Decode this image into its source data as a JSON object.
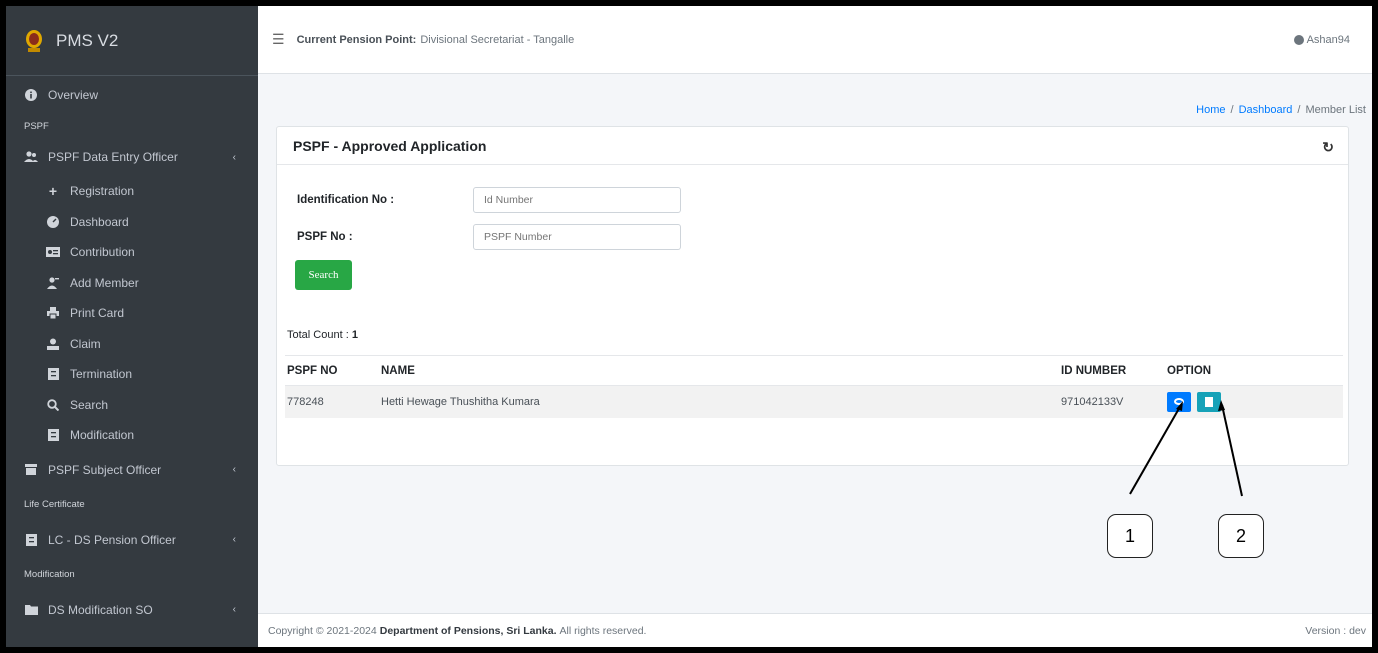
{
  "brand": {
    "title": "PMS V2"
  },
  "sidebar": {
    "overview": "Overview",
    "header_pspf": "PSPF",
    "group_data_entry": "PSPF Data Entry Officer",
    "items": [
      {
        "label": "Registration",
        "icon": "plus-icon"
      },
      {
        "label": "Dashboard",
        "icon": "dashboard-icon"
      },
      {
        "label": "Contribution",
        "icon": "id-card-icon"
      },
      {
        "label": "Add Member",
        "icon": "user-add-icon"
      },
      {
        "label": "Print Card",
        "icon": "print-icon"
      },
      {
        "label": "Claim",
        "icon": "user-id-icon"
      },
      {
        "label": "Termination",
        "icon": "file-icon"
      },
      {
        "label": "Search",
        "icon": "search-icon"
      },
      {
        "label": "Modification",
        "icon": "file-icon"
      }
    ],
    "group_subject_officer": "PSPF Subject Officer",
    "header_life_certificate": "Life Certificate",
    "group_lc_ds": "LC - DS Pension Officer",
    "header_modification": "Modification",
    "group_ds_mod": "DS Modification SO"
  },
  "topbar": {
    "pension_point_label": "Current Pension Point:",
    "pension_point_value": "Divisional Secretariat - Tangalle",
    "username": "Ashan94"
  },
  "breadcrumb": {
    "home": "Home",
    "dashboard": "Dashboard",
    "current": "Member List"
  },
  "card": {
    "title": "PSPF - Approved Application",
    "id_label": "Identification No :",
    "id_placeholder": "Id Number",
    "pspf_label": "PSPF No :",
    "pspf_placeholder": "PSPF Number",
    "search_button": "Search",
    "total_label": "Total Count :",
    "total_value": "1"
  },
  "table": {
    "headers": [
      "PSPF NO",
      "NAME",
      "ID NUMBER",
      "OPTION"
    ],
    "rows": [
      {
        "pspf_no": "778248",
        "name": "Hetti Hewage Thushitha Kumara",
        "id_number": "971042133V"
      }
    ]
  },
  "footer": {
    "copyright_prefix": "Copyright © 2021-2024",
    "org": "Department of Pensions, Sri Lanka.",
    "suffix": "All rights reserved.",
    "version": "Version : dev"
  },
  "annotations": [
    "1",
    "2"
  ],
  "colors": {
    "sidebar": "#343a40",
    "primary": "#007bff",
    "success": "#28a745",
    "info": "#17a2b8"
  }
}
